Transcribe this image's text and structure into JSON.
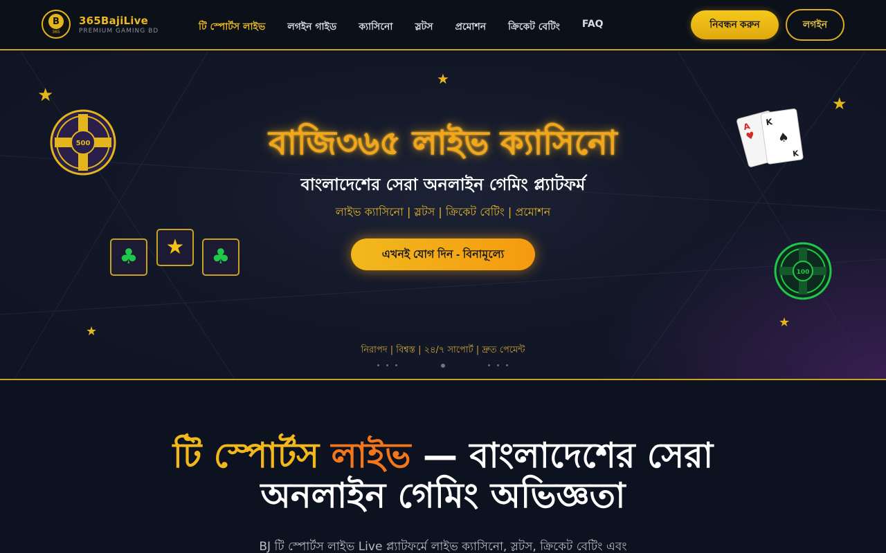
{
  "logo": {
    "badge_letter": "B",
    "badge_number": "365",
    "title": "365BajiLive",
    "subtitle": "PREMIUM GAMING BD"
  },
  "nav": {
    "items": [
      {
        "label": "টি স্পোর্টস লাইভ",
        "active": true
      },
      {
        "label": "লগইন গাইড"
      },
      {
        "label": "ক্যাসিনো"
      },
      {
        "label": "স্লটস"
      },
      {
        "label": "প্রমোশন"
      },
      {
        "label": "ক্রিকেট বেটিং"
      },
      {
        "label": "FAQ"
      }
    ],
    "register_label": "নিবন্ধন করুন",
    "login_label": "লগইন"
  },
  "hero": {
    "title": "বাজি৩৬৫ লাইভ ক্যাসিনো",
    "subtitle": "বাংলাদেশের সেরা অনলাইন গেমিং প্ল্যাটফর্ম",
    "tags": "লাইভ ক্যাসিনো | স্লটস | ক্রিকেট বেটিং | প্রমোশন",
    "cta_label": "এখনই যোগ দিন - বিনামূল্যে",
    "footer": "নিরাপদ | বিশ্বস্ত | ২৪/৭ সাপোর্ট | দ্রুত পেমেন্ট",
    "chip_gold_value": "500",
    "chip_green_value": "100",
    "cards": [
      {
        "rank": "A",
        "suit": "♥"
      },
      {
        "rank": "K",
        "suit": "♠"
      }
    ],
    "slot_symbols": [
      "♣",
      "★",
      "♣"
    ],
    "colors": {
      "gold": "#f2b81b",
      "orange": "#f2761a",
      "green": "#1fc84a"
    }
  },
  "section": {
    "title_hl1": "টি স্পোর্টস",
    "title_hl2": "লাইভ",
    "title_rest": " — বাংলাদেশের সেরা",
    "title_line2": "অনলাইন গেমিং অভিজ্ঞতা",
    "description": "BJ টি স্পোর্টস লাইভ Live প্ল্যাটফর্মে লাইভ ক্যাসিনো, স্লটস, ক্রিকেট বেটিং এবং"
  }
}
